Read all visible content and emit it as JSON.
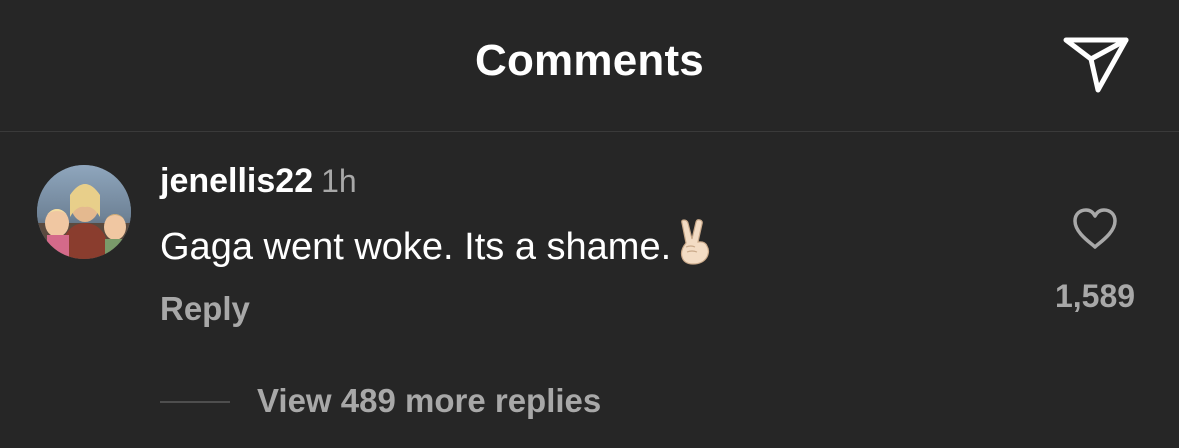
{
  "header": {
    "title": "Comments",
    "share_icon": "paper-plane-icon"
  },
  "comment": {
    "username": "jenellis22",
    "time": "1h",
    "text": "Gaga went woke. Its a shame.",
    "emoji": "victory-hand-emoji",
    "reply_label": "Reply",
    "like_icon": "heart-outline-icon",
    "like_count": "1,589",
    "view_replies_label": "View 489 more replies"
  },
  "colors": {
    "background": "#262626",
    "primary_text": "#ffffff",
    "secondary_text": "#a8a8a8",
    "divider": "#3a3a3a"
  }
}
